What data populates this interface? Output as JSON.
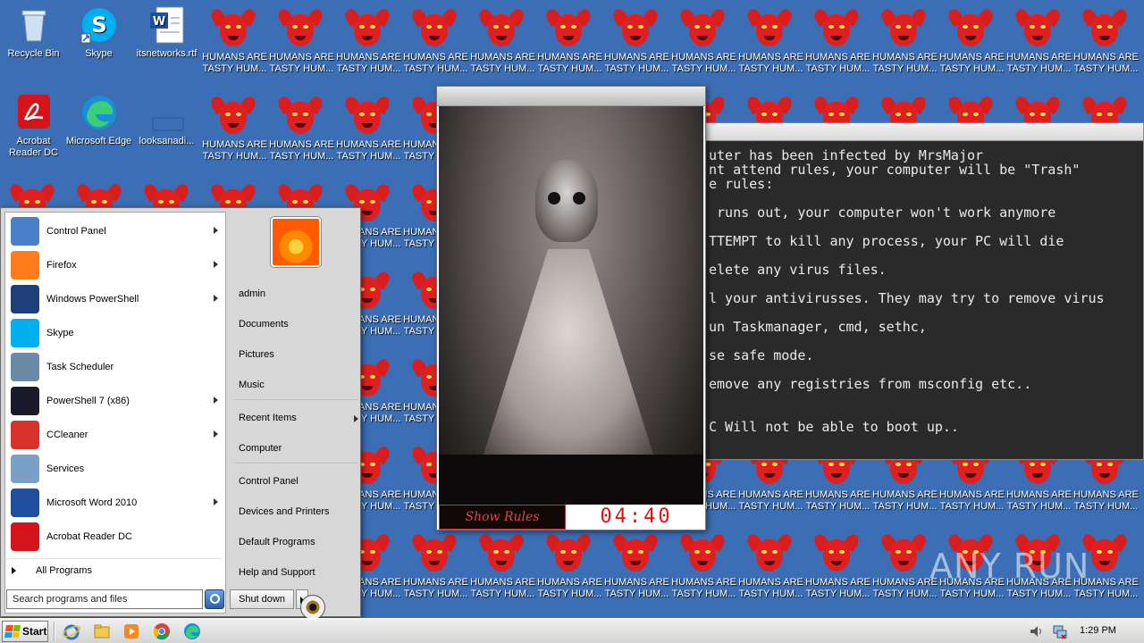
{
  "desktop": {
    "wallpaper_caption_line1": "HUMANS ARE",
    "wallpaper_caption_line2": "TASTY HUM...",
    "icons": [
      {
        "label": "Recycle Bin"
      },
      {
        "label": "Skype"
      },
      {
        "label": "itsnetworks.rtf"
      },
      {
        "label": "Acrobat Reader DC"
      },
      {
        "label": "Microsoft Edge"
      },
      {
        "label": "looksanadi..."
      }
    ]
  },
  "rules_window": {
    "lines": [
      "uter has been infected by MrsMajor",
      "nt attend rules, your computer will be \"Trash\"",
      "e rules:",
      "",
      " runs out, your computer won't work anymore",
      "",
      "TTEMPT to kill any process, your PC will die",
      "",
      "elete any virus files.",
      "",
      "l your antivirusses. They may try to remove virus",
      "",
      "un Taskmanager, cmd, sethc,",
      "",
      "se safe mode.",
      "",
      "emove any registries from msconfig etc..",
      "",
      "",
      "C Will not be able to boot up.."
    ]
  },
  "doll_window": {
    "show_rules_label": "Show Rules",
    "timer": "04:40"
  },
  "start_menu": {
    "programs": [
      {
        "label": "Control Panel",
        "icon": "control-panel-icon",
        "arrow": true
      },
      {
        "label": "Firefox",
        "icon": "firefox-icon",
        "arrow": true
      },
      {
        "label": "Windows PowerShell",
        "icon": "powershell-icon",
        "arrow": true
      },
      {
        "label": "Skype",
        "icon": "skype-icon",
        "arrow": false
      },
      {
        "label": "Task Scheduler",
        "icon": "task-scheduler-icon",
        "arrow": false
      },
      {
        "label": "PowerShell 7 (x86)",
        "icon": "powershell7-icon",
        "arrow": true
      },
      {
        "label": "CCleaner",
        "icon": "ccleaner-icon",
        "arrow": true
      },
      {
        "label": "Services",
        "icon": "services-icon",
        "arrow": false
      },
      {
        "label": "Microsoft Word 2010",
        "icon": "word-icon",
        "arrow": true
      },
      {
        "label": "Acrobat Reader DC",
        "icon": "acrobat-icon",
        "arrow": false
      }
    ],
    "all_programs": "All Programs",
    "search_placeholder": "Search programs and files",
    "right": {
      "user": "admin",
      "documents": "Documents",
      "pictures": "Pictures",
      "music": "Music",
      "recent_items": "Recent Items",
      "computer": "Computer",
      "control_panel": "Control Panel",
      "devices_printers": "Devices and Printers",
      "default_programs": "Default Programs",
      "help_support": "Help and Support"
    },
    "shutdown_label": "Shut down"
  },
  "taskbar": {
    "start_label": "Start",
    "clock": "1:29 PM"
  },
  "watermark": "ANY RUN",
  "colors": {
    "desktop": "#3b6eb4",
    "devil_red": "#e02020",
    "timer_red": "#e01010"
  }
}
